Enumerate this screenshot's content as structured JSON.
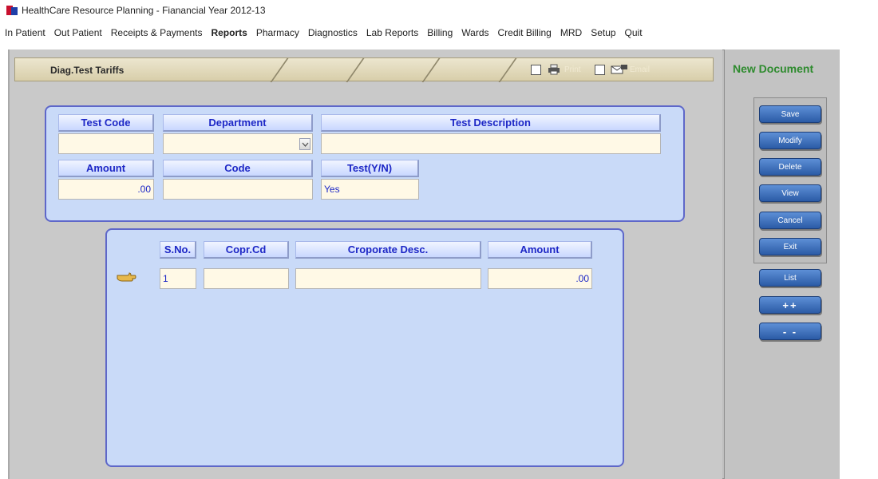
{
  "window": {
    "title": "HealthCare Resource Planning - Fianancial Year 2012-13"
  },
  "menu": [
    {
      "label": "In Patient",
      "active": false
    },
    {
      "label": "Out Patient",
      "active": false
    },
    {
      "label": "Receipts & Payments",
      "active": false
    },
    {
      "label": "Reports",
      "active": true
    },
    {
      "label": "Pharmacy",
      "active": false
    },
    {
      "label": "Diagnostics",
      "active": false
    },
    {
      "label": "Lab Reports",
      "active": false
    },
    {
      "label": "Billing",
      "active": false
    },
    {
      "label": "Wards",
      "active": false
    },
    {
      "label": "Credit Billing",
      "active": false
    },
    {
      "label": "MRD",
      "active": false
    },
    {
      "label": "Setup",
      "active": false
    },
    {
      "label": "Quit",
      "active": false
    }
  ],
  "doc": {
    "title": "Diag.Test Tariffs",
    "print_label": "Print",
    "email_label": "Email",
    "status": "New Document"
  },
  "form": {
    "test_code": {
      "label": "Test Code",
      "value": ""
    },
    "department": {
      "label": "Department",
      "value": ""
    },
    "test_description": {
      "label": "Test Description",
      "value": ""
    },
    "amount": {
      "label": "Amount",
      "value": ".00"
    },
    "code": {
      "label": "Code",
      "value": ""
    },
    "test_yn": {
      "label": "Test(Y/N)",
      "value": "Yes"
    }
  },
  "grid": {
    "columns": [
      "S.No.",
      "Copr.Cd",
      "Croporate Desc.",
      "Amount"
    ],
    "rows": [
      {
        "sno": "1",
        "copr_cd": "",
        "desc": "",
        "amount": ".00"
      }
    ]
  },
  "buttons": {
    "save": "Save",
    "modify": "Modify",
    "delete": "Delete",
    "view": "View",
    "cancel": "Cancel",
    "exit": "Exit",
    "list": "List",
    "add_row": "++",
    "remove_row": "- -"
  },
  "icons": {
    "app": "app-icon",
    "print": "printer-icon",
    "email": "email-icon",
    "pointer": "pointing-hand-icon",
    "dropdown": "chevron-down-icon"
  },
  "colors": {
    "accent_blue": "#1d27c6",
    "panel_bg": "#c9daf8",
    "status_green": "#2e8b2e",
    "button_blue": "#2b5ba6"
  }
}
